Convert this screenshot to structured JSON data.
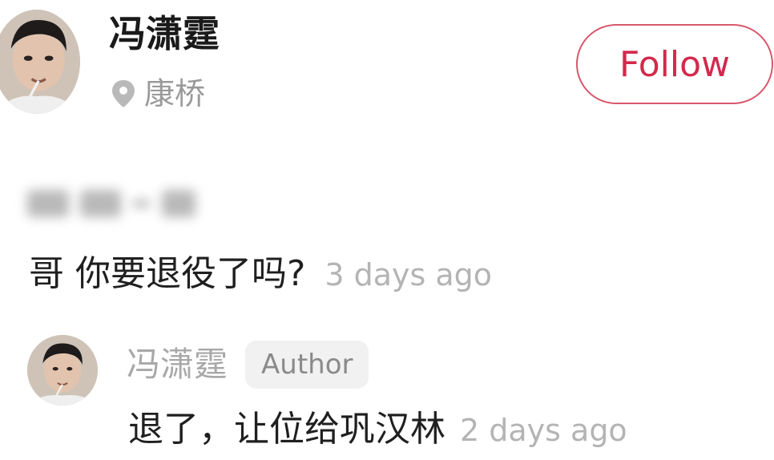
{
  "profile": {
    "name": "冯潇霆",
    "location": "康桥",
    "follow_label": "Follow",
    "avatar_icon": "user-avatar-icon",
    "location_icon": "location-pin-icon"
  },
  "comment": {
    "text": "哥 你要退役了吗?",
    "time": "3 days ago"
  },
  "reply": {
    "name": "冯潇霆",
    "badge": "Author",
    "text": "退了，让位给巩汉林",
    "time": "2 days ago"
  },
  "colors": {
    "accent": "#d4294c",
    "muted": "#a8a8a8",
    "text": "#1f1f1f"
  }
}
